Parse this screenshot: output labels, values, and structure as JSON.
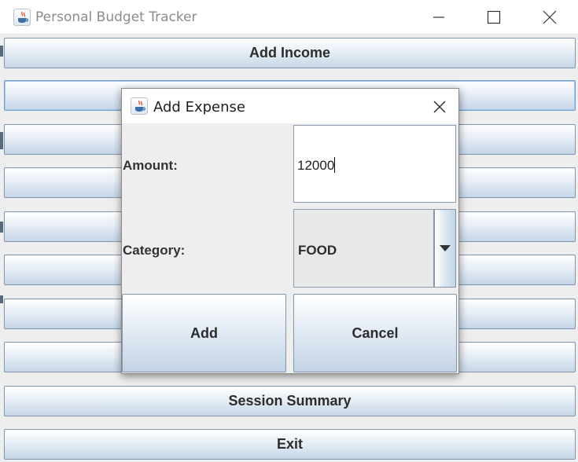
{
  "main_window": {
    "title": "Personal Budget Tracker",
    "icon": "java-coffee-cup-icon",
    "controls": [
      "minimize-icon",
      "maximize-icon",
      "close-icon"
    ],
    "buttons": [
      {
        "label": "Add Income",
        "focused": false
      },
      {
        "label": "",
        "focused": true
      },
      {
        "label": "",
        "focused": false
      },
      {
        "label": "",
        "focused": false
      },
      {
        "label": "",
        "focused": false
      },
      {
        "label": "",
        "focused": false
      },
      {
        "label": "",
        "focused": false
      },
      {
        "label": "",
        "focused": false
      },
      {
        "label": "Session Summary",
        "focused": false
      },
      {
        "label": "Exit",
        "focused": false
      }
    ],
    "button_colors": {
      "top": "#ffffff",
      "bottom": "#c6d6e7",
      "border": "#7f94ad"
    }
  },
  "dialog": {
    "title": "Add Expense",
    "icon": "java-coffee-cup-icon",
    "amount_label": "Amount:",
    "amount_value": "12000",
    "category_label": "Category:",
    "category_value": "FOOD",
    "add_label": "Add",
    "cancel_label": "Cancel"
  }
}
